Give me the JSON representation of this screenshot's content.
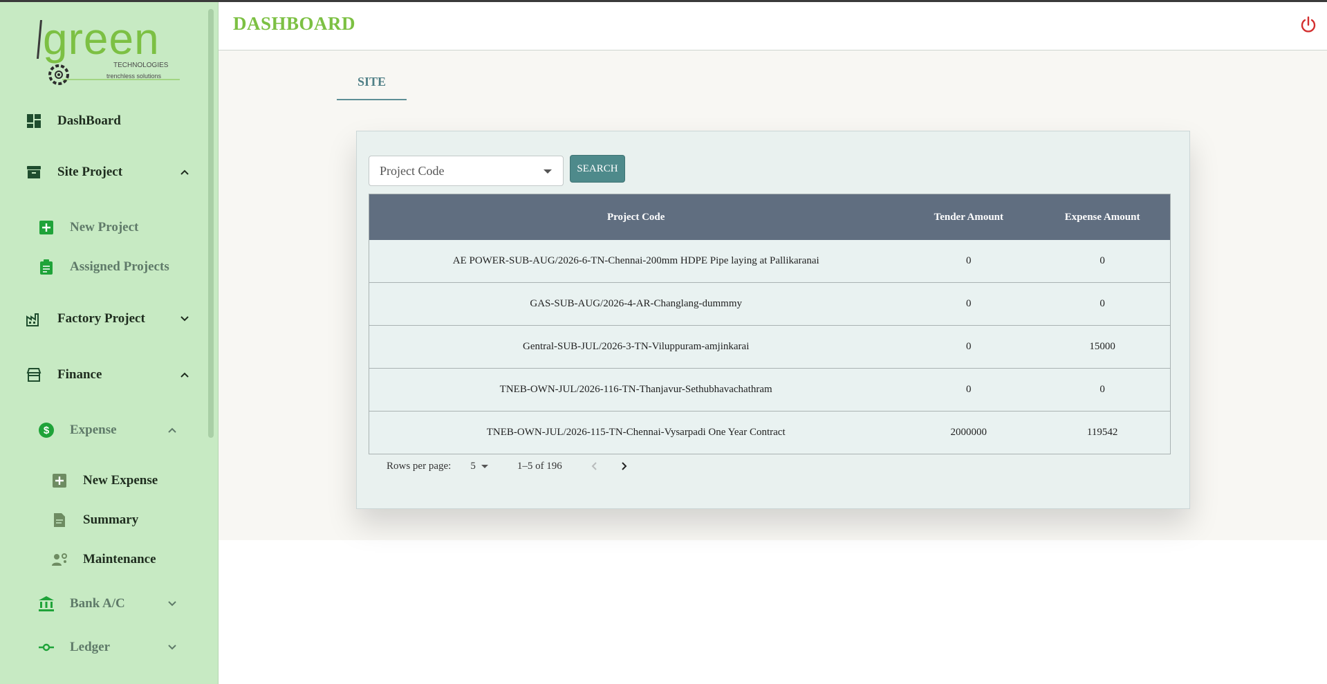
{
  "brand": {
    "name": "green",
    "tagline_1": "TECHNOLOGIES",
    "tagline_2": "trenchless solutions"
  },
  "header": {
    "title": "DASHBOARD"
  },
  "sidebar": {
    "items": [
      {
        "label": "DashBoard",
        "icon": "dashboard-icon"
      },
      {
        "label": "Site Project",
        "icon": "archive-icon"
      },
      {
        "label": "New Project",
        "icon": "add-box-icon"
      },
      {
        "label": "Assigned Projects",
        "icon": "clipboard-icon"
      },
      {
        "label": "Factory Project",
        "icon": "factory-icon"
      },
      {
        "label": "Finance",
        "icon": "store-icon"
      },
      {
        "label": "Expense",
        "icon": "dollar-icon"
      },
      {
        "label": "New Expense",
        "icon": "add-box-icon"
      },
      {
        "label": "Summary",
        "icon": "document-icon"
      },
      {
        "label": "Maintenance",
        "icon": "engineering-icon"
      },
      {
        "label": "Bank A/C",
        "icon": "bank-icon"
      },
      {
        "label": "Ledger",
        "icon": "commit-icon"
      }
    ]
  },
  "tabs": [
    {
      "label": "SITE",
      "active": true
    }
  ],
  "filters": {
    "project_code_placeholder": "Project Code",
    "search_label": "SEARCH"
  },
  "table": {
    "columns": [
      "Project Code",
      "Tender Amount",
      "Expense Amount"
    ],
    "rows": [
      [
        "AE POWER-SUB-AUG/2026-6-TN-Chennai-200mm HDPE Pipe laying at Pallikaranai",
        "0",
        "0"
      ],
      [
        "GAS-SUB-AUG/2026-4-AR-Changlang-dummmy",
        "0",
        "0"
      ],
      [
        "Gentral-SUB-JUL/2026-3-TN-Viluppuram-amjinkarai",
        "0",
        "15000"
      ],
      [
        "TNEB-OWN-JUL/2026-116-TN-Thanjavur-Sethubhavachathram",
        "0",
        "0"
      ],
      [
        "TNEB-OWN-JUL/2026-115-TN-Chennai-Vysarpadi One Year Contract",
        "2000000",
        "119542"
      ]
    ]
  },
  "pagination": {
    "rows_per_page_label": "Rows per page:",
    "rows_per_page": "5",
    "range": "1–5 of 196"
  },
  "colors": {
    "accent_green": "#7cc043",
    "sidebar_bg": "#c7eac3",
    "table_header": "#606e80",
    "search_button": "#4e8a8b",
    "power_red": "#d32f2f"
  }
}
